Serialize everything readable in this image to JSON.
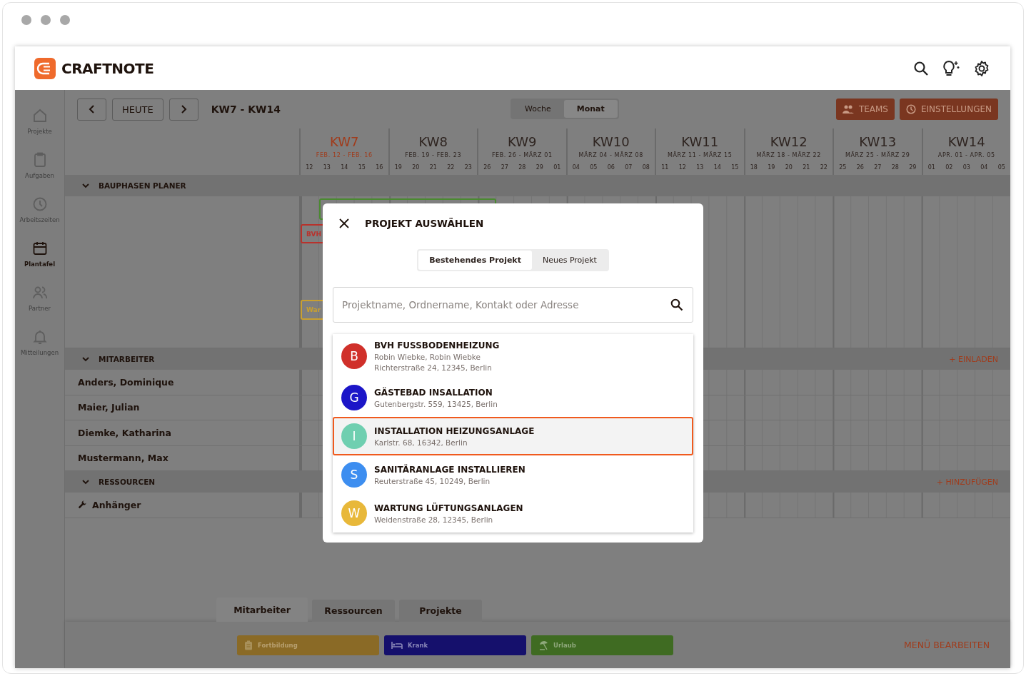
{
  "app": {
    "brand": "CRAFTNOTE"
  },
  "sidebar": {
    "items": [
      {
        "label": "Projekte",
        "selected": false
      },
      {
        "label": "Aufgaben",
        "selected": false
      },
      {
        "label": "Arbeitszeiten",
        "selected": false
      },
      {
        "label": "Plantafel",
        "selected": true
      },
      {
        "label": "Partner",
        "selected": false
      },
      {
        "label": "Mitteilungen",
        "selected": false
      }
    ]
  },
  "toolbar": {
    "today": "HEUTE",
    "range": "KW7 - KW14",
    "views": [
      {
        "label": "Woche",
        "selected": false
      },
      {
        "label": "Monat",
        "selected": true
      }
    ],
    "buttons": [
      "TEAMS",
      "EINSTELLUNGEN"
    ]
  },
  "weeks": [
    {
      "label": "KW7",
      "dates": "FEB. 12 - FEB. 16",
      "days": [
        "12",
        "13",
        "14",
        "15",
        "16"
      ],
      "current": true
    },
    {
      "label": "KW8",
      "dates": "FEB. 19 - FEB. 23",
      "days": [
        "19",
        "20",
        "21",
        "22",
        "23"
      ],
      "current": false
    },
    {
      "label": "KW9",
      "dates": "FEB. 26 - MÄRZ 01",
      "days": [
        "26",
        "27",
        "28",
        "29",
        "01"
      ],
      "current": false
    },
    {
      "label": "KW10",
      "dates": "MÄRZ 04 - MÄRZ 08",
      "days": [
        "04",
        "05",
        "06",
        "07",
        "08"
      ],
      "current": false
    },
    {
      "label": "KW11",
      "dates": "MÄRZ 11 - MÄRZ 15",
      "days": [
        "11",
        "12",
        "13",
        "14",
        "15"
      ],
      "current": false
    },
    {
      "label": "KW12",
      "dates": "MÄRZ 18 - MÄRZ 22",
      "days": [
        "18",
        "19",
        "20",
        "21",
        "22"
      ],
      "current": false
    },
    {
      "label": "KW13",
      "dates": "MÄRZ 25 - MÄRZ 29",
      "days": [
        "25",
        "26",
        "27",
        "28",
        "29"
      ],
      "current": false
    },
    {
      "label": "KW14",
      "dates": "APR. 01 - APR. 05",
      "days": [
        "01",
        "02",
        "03",
        "04",
        "05"
      ],
      "current": false
    }
  ],
  "bauphasen": {
    "title": "BAUPHASEN PLANER",
    "expanded": true,
    "bars": [
      {
        "label": "BVH",
        "color": "#b8322c"
      },
      {
        "label": "War",
        "color": "#c9a030"
      }
    ]
  },
  "mitarbeiter": {
    "title": "MITARBEITER",
    "expanded": true,
    "action": "+ EINLADEN",
    "rows": [
      "Anders, Dominique",
      "Maier, Julian",
      "Diemke, Katharina",
      "Mustermann, Max"
    ]
  },
  "ressourcen": {
    "title": "RESSOURCEN",
    "expanded": true,
    "action": "+ HINZUFÜGEN",
    "rows": [
      "Anhänger"
    ]
  },
  "bottom_panel": {
    "tabs": [
      {
        "label": "Mitarbeiter",
        "selected": true
      },
      {
        "label": "Ressourcen",
        "selected": false
      },
      {
        "label": "Projekte",
        "selected": false
      }
    ],
    "chips": [
      {
        "label": "Fortbildung",
        "color": "#8a6a26"
      },
      {
        "label": "Krank",
        "color": "#15106c"
      },
      {
        "label": "Urlaub",
        "color": "#3f6b22"
      }
    ],
    "edit": "MENÜ BEARBEITEN"
  },
  "modal": {
    "title": "PROJEKT AUSWÄHLEN",
    "tabs": [
      {
        "label": "Bestehendes Projekt",
        "selected": true
      },
      {
        "label": "Neues Projekt",
        "selected": false
      }
    ],
    "search": {
      "placeholder": "Projektname, Ordnername, Kontakt oder Adresse"
    },
    "projects": [
      {
        "initial": "B",
        "title": "BVH FUSSBODENHEIZUNG",
        "lines": [
          "Robin Wiebke, Robin Wiebke",
          "Richterstraße 24, 12345, Berlin"
        ],
        "color": "#d0302a",
        "selected": false
      },
      {
        "initial": "G",
        "title": "GÄSTEBAD INSALLATION",
        "lines": [
          "Gutenbergstr. 559, 13425, Berlin"
        ],
        "color": "#1c16c8",
        "selected": false
      },
      {
        "initial": "I",
        "title": "INSTALLATION HEIZUNGSANLAGE",
        "lines": [
          "Karlstr. 68, 16342, Berlin"
        ],
        "color": "#6fcfb0",
        "selected": true
      },
      {
        "initial": "S",
        "title": "SANITÄRANLAGE INSTALLIEREN",
        "lines": [
          "Reuterstraße 45, 10249, Berlin"
        ],
        "color": "#3d8ef0",
        "selected": false
      },
      {
        "initial": "W",
        "title": "WARTUNG LÜFTUNGSANLAGEN",
        "lines": [
          "Weidenstraße 28, 12345, Berlin"
        ],
        "color": "#e8b83a",
        "selected": false
      }
    ]
  }
}
